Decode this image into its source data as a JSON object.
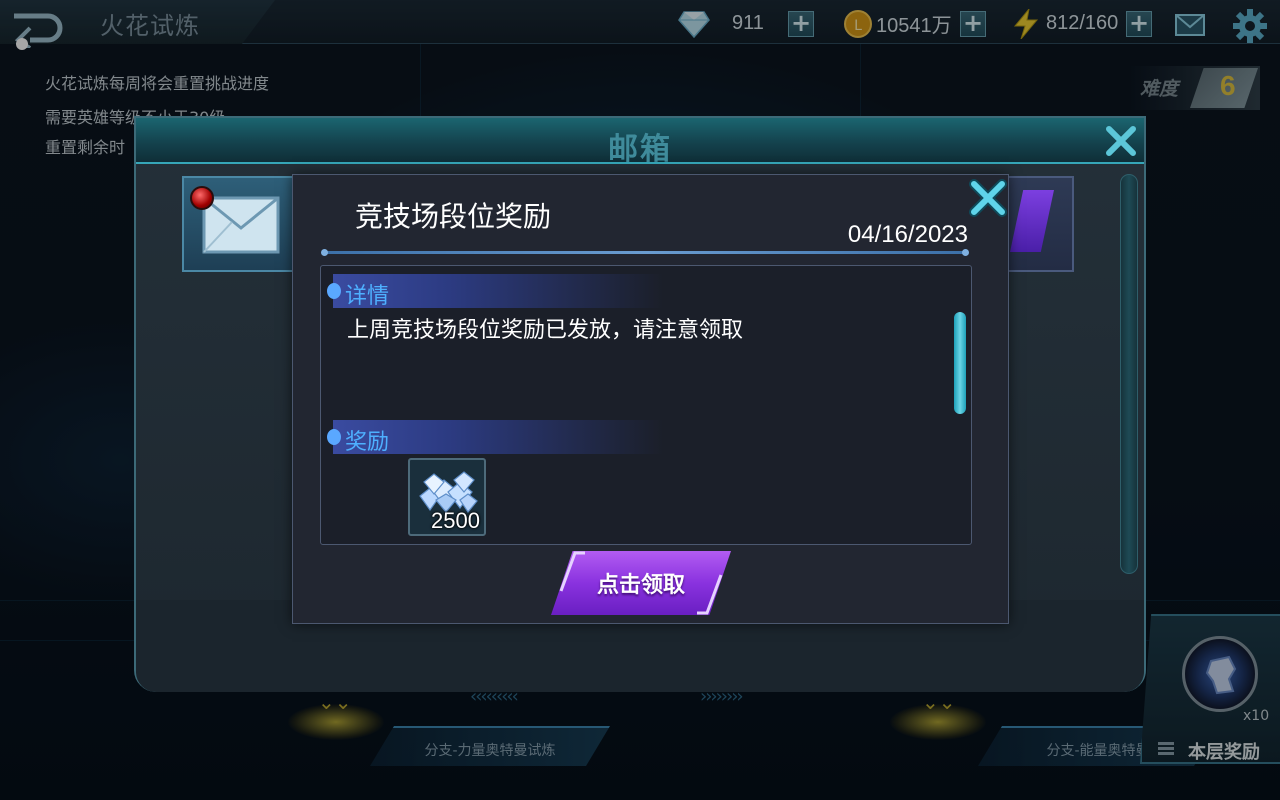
{
  "header": {
    "title": "火花试炼",
    "diamonds": "911",
    "gold": "10541万",
    "energy": "812/160"
  },
  "info": {
    "line1": "火花试炼每周将会重置挑战进度",
    "line2": "需要英雄等级不小于30级",
    "line3": "重置剩余时"
  },
  "difficulty": {
    "label": "难度",
    "value": "6"
  },
  "bottom": {
    "branch_left": "分支-力量奥特曼试炼",
    "branch_right": "分支-能量奥特曼",
    "floor_reward_label": "本层奖励",
    "floor_reward_count": "x10"
  },
  "mailbox": {
    "title": "邮箱"
  },
  "mail": {
    "title": "竞技场段位奖励",
    "date": "04/16/2023",
    "details_heading": "详情",
    "details_text": "上周竞技场段位奖励已发放，请注意领取",
    "rewards_heading": "奖励",
    "rewards": [
      {
        "icon": "diamond-pile-icon",
        "count": "2500"
      }
    ],
    "claim_label": "点击领取"
  },
  "colors": {
    "accent_teal": "#36a6b8",
    "section_blue": "#4eb0ff",
    "claim_purple": "#8a32df",
    "difficulty_gold": "#e0c441"
  }
}
